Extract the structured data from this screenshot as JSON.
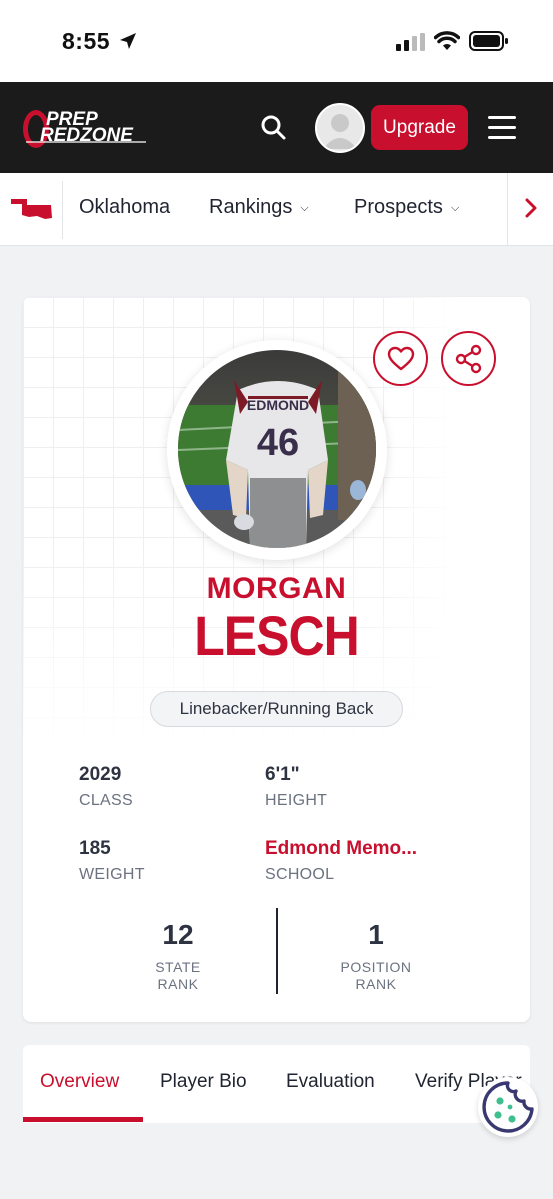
{
  "status_bar": {
    "time": "8:55"
  },
  "navbar": {
    "logo_line1": "PREP",
    "logo_line2": "REDZONE",
    "upgrade_label": "Upgrade"
  },
  "subnav": {
    "state": "Oklahoma",
    "items": [
      {
        "label": "Rankings"
      },
      {
        "label": "Prospects"
      }
    ]
  },
  "player": {
    "first_name": "MORGAN",
    "last_name": "LESCH",
    "position": "Linebacker/Running Back",
    "jersey_text": "EDMOND",
    "jersey_number": "46",
    "stats": [
      {
        "value": "2029",
        "label": "CLASS"
      },
      {
        "value": "6'1\"",
        "label": "HEIGHT"
      },
      {
        "value": "185",
        "label": "WEIGHT"
      },
      {
        "value": "Edmond Memo...",
        "label": "SCHOOL"
      }
    ],
    "ranks": [
      {
        "value": "12",
        "label_line1": "STATE",
        "label_line2": "RANK"
      },
      {
        "value": "1",
        "label_line1": "POSITION",
        "label_line2": "RANK"
      }
    ]
  },
  "tabs": [
    {
      "label": "Overview",
      "active": true
    },
    {
      "label": "Player Bio",
      "active": false
    },
    {
      "label": "Evaluation",
      "active": false
    },
    {
      "label": "Verify Player",
      "active": false
    }
  ],
  "colors": {
    "brand_red": "#c8102e",
    "nav_dark": "#1b1b1b",
    "page_bg": "#f1f2f4"
  },
  "icons": [
    "location-arrow-icon",
    "signal-icon",
    "wifi-icon",
    "battery-icon",
    "search-icon",
    "user-avatar-icon",
    "hamburger-menu-icon",
    "oklahoma-state-icon",
    "chevron-down-icon",
    "chevron-right-icon",
    "heart-icon",
    "share-icon",
    "cookie-icon"
  ]
}
